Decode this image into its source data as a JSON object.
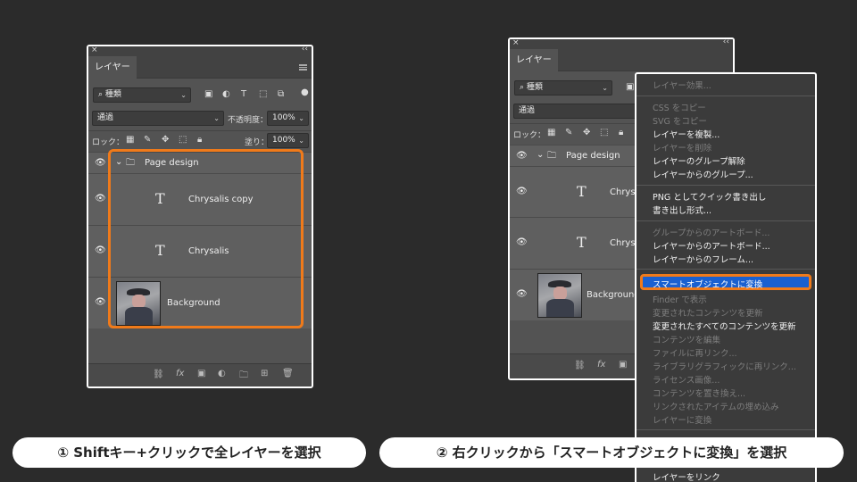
{
  "colors": {
    "background": "#2b2b2b",
    "accent": "#f07a1a",
    "highlight": "#1a60d0",
    "panel": "#535353"
  },
  "panel_left": {
    "close": "×",
    "collapse": "‹‹",
    "tab": "レイヤー",
    "filter_value": "種類",
    "blend_mode": "通過",
    "opacity_label": "不透明度：",
    "opacity_value": "100%",
    "lock_label": "ロック：",
    "fill_label": "塗り：",
    "fill_value": "100%",
    "layers": {
      "group": "Page design",
      "text1": "Chrysalis copy",
      "text2": "Chrysalis",
      "bg": "Background"
    }
  },
  "panel_right": {
    "close": "×",
    "collapse": "‹‹",
    "tab": "レイヤー",
    "filter_value": "種類",
    "blend_mode": "通過",
    "lock_label": "ロック：",
    "layers": {
      "group": "Page design",
      "text1": "Chrysa",
      "text2": "Chrysa",
      "bg": "Background"
    }
  },
  "context_menu": {
    "items": [
      {
        "label": "レイヤー効果...",
        "enabled": false
      },
      {
        "label": "CSS をコピー",
        "enabled": false
      },
      {
        "label": "SVG をコピー",
        "enabled": false
      },
      {
        "label": "レイヤーを複製...",
        "enabled": true
      },
      {
        "label": "レイヤーを削除",
        "enabled": false
      },
      {
        "label": "レイヤーのグループ解除",
        "enabled": true
      },
      {
        "label": "レイヤーからのグループ...",
        "enabled": true
      },
      {
        "label": "PNG としてクイック書き出し",
        "enabled": true
      },
      {
        "label": "書き出し形式...",
        "enabled": true
      },
      {
        "label": "グループからのアートボード...",
        "enabled": false
      },
      {
        "label": "レイヤーからのアートボード...",
        "enabled": true
      },
      {
        "label": "レイヤーからのフレーム...",
        "enabled": true
      },
      {
        "label": "スマートオブジェクトに変換",
        "enabled": true,
        "highlighted": true
      },
      {
        "label": "Finder で表示",
        "enabled": false
      },
      {
        "label": "変更されたコンテンツを更新",
        "enabled": false
      },
      {
        "label": "変更されたすべてのコンテンツを更新",
        "enabled": true
      },
      {
        "label": "コンテンツを編集",
        "enabled": false
      },
      {
        "label": "ファイルに再リンク...",
        "enabled": false
      },
      {
        "label": "ライブラリグラフィックに再リンク...",
        "enabled": false
      },
      {
        "label": "ライセンス画像...",
        "enabled": false
      },
      {
        "label": "コンテンツを置き換え...",
        "enabled": false
      },
      {
        "label": "リンクされたアイテムの埋め込み",
        "enabled": false
      },
      {
        "label": "レイヤーに変換",
        "enabled": false
      },
      {
        "label": "レイヤーをリンク",
        "enabled": true
      }
    ]
  },
  "captions": {
    "step1": "① Shiftキー+クリックで全レイヤーを選択",
    "step2": "② 右クリックから「スマートオブジェクトに変換」を選択"
  }
}
